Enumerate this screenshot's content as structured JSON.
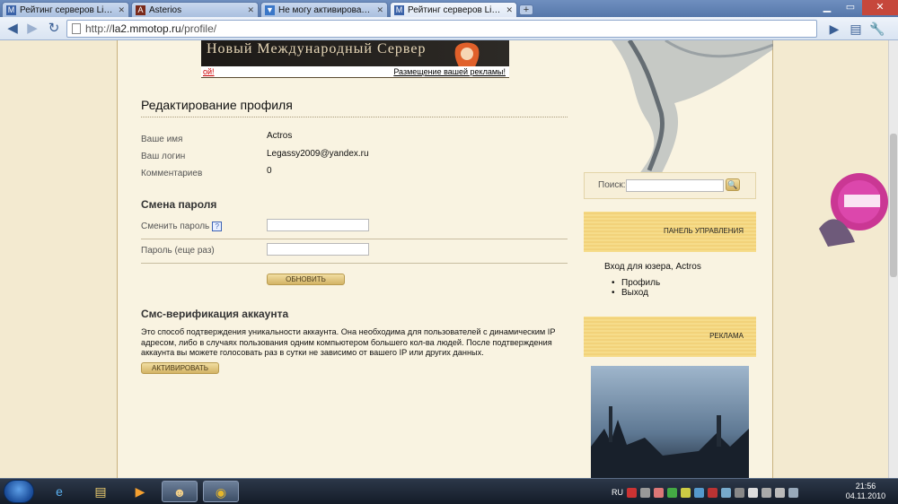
{
  "browser": {
    "tabs": [
      {
        "title": "Рейтинг серверов Linea...",
        "icon": "m-logo-icon",
        "color": "#3a62a8"
      },
      {
        "title": "Asterios",
        "icon": "asterios-icon",
        "color": "#7a2a1a"
      },
      {
        "title": "Не могу активировать а...",
        "icon": "forum-icon",
        "color": "#3a77c8"
      },
      {
        "title": "Рейтинг серверов Linea...",
        "icon": "m-logo-icon",
        "color": "#3a62a8"
      }
    ],
    "url_prefix": "http://",
    "url_host": "la2.mmotop.ru",
    "url_path": "/profile/"
  },
  "banner": {
    "headline": "Новый Международный Сервер",
    "left_link": "ой!",
    "ad_link": "Размещение вашей рекламы!"
  },
  "profile": {
    "title": "Редактирование профиля",
    "fields": [
      {
        "label": "Ваше имя",
        "value": "Actros"
      },
      {
        "label": "Ваш логин",
        "value": "Legassy2009@yandex.ru"
      },
      {
        "label": "Комментариев",
        "value": "0"
      }
    ]
  },
  "password": {
    "title": "Смена пароля",
    "change_label": "Сменить пароль",
    "help": "?",
    "repeat_label": "Пароль (еще раз)",
    "submit": "Обновить"
  },
  "sms": {
    "title": "Смс-верификация аккаунта",
    "description": "Это способ подтверждения уникальности аккаунта. Она необходима для пользователей с динамическим IP адресом, либо в случаях пользования одним компьютером большего кол-ва людей. После подтверждения аккаунта вы можете голосовать раз в сутки не зависимо от вашего IP или других данных.",
    "activate": "Активировать"
  },
  "sidebar": {
    "search_label": "Поиск:",
    "control_panel": "Панель управления",
    "user_line": "Вход для юзера, Actros",
    "links": [
      "Профиль",
      "Выход"
    ],
    "ads_title": "Реклама"
  },
  "taskbar": {
    "lang": "RU",
    "time": "21:56",
    "date": "04.11.2010"
  },
  "colors": {
    "page_bg": "#f3ead0",
    "accent_gold": "#d3b365",
    "panel_yellow": "#f6dc8a"
  }
}
